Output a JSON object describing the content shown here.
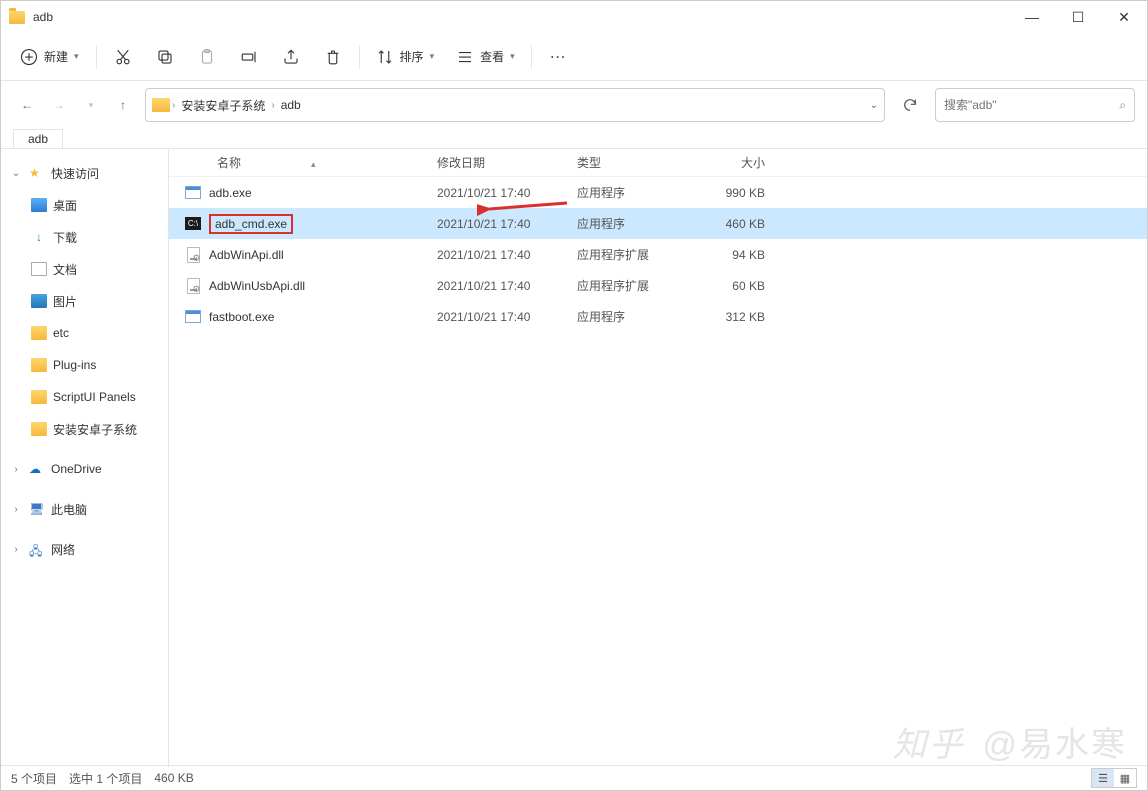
{
  "window": {
    "title": "adb"
  },
  "toolbar": {
    "new_label": "新建",
    "sort_label": "排序",
    "view_label": "查看"
  },
  "breadcrumbs": {
    "items": [
      "安装安卓子系统",
      "adb"
    ]
  },
  "search": {
    "placeholder": "搜索\"adb\""
  },
  "tab": {
    "label": "adb"
  },
  "sidebar": {
    "quick_access": "快速访问",
    "desktop": "桌面",
    "downloads": "下载",
    "documents": "文档",
    "pictures": "图片",
    "etc": "etc",
    "plugins": "Plug-ins",
    "scriptui": "ScriptUI Panels",
    "android": "安装安卓子系统",
    "onedrive": "OneDrive",
    "thispc": "此电脑",
    "network": "网络"
  },
  "columns": {
    "name": "名称",
    "date": "修改日期",
    "type": "类型",
    "size": "大小"
  },
  "files": [
    {
      "name": "adb.exe",
      "date": "2021/10/21 17:40",
      "type": "应用程序",
      "size": "990 KB",
      "icon": "exe"
    },
    {
      "name": "adb_cmd.exe",
      "date": "2021/10/21 17:40",
      "type": "应用程序",
      "size": "460 KB",
      "icon": "cmd",
      "selected": true,
      "highlighted": true
    },
    {
      "name": "AdbWinApi.dll",
      "date": "2021/10/21 17:40",
      "type": "应用程序扩展",
      "size": "94 KB",
      "icon": "dll"
    },
    {
      "name": "AdbWinUsbApi.dll",
      "date": "2021/10/21 17:40",
      "type": "应用程序扩展",
      "size": "60 KB",
      "icon": "dll"
    },
    {
      "name": "fastboot.exe",
      "date": "2021/10/21 17:40",
      "type": "应用程序",
      "size": "312 KB",
      "icon": "exe"
    }
  ],
  "statusbar": {
    "count": "5 个项目",
    "selection": "选中 1 个项目",
    "size": "460 KB"
  },
  "watermark": {
    "brand": "知乎",
    "author": "@易水寒"
  }
}
